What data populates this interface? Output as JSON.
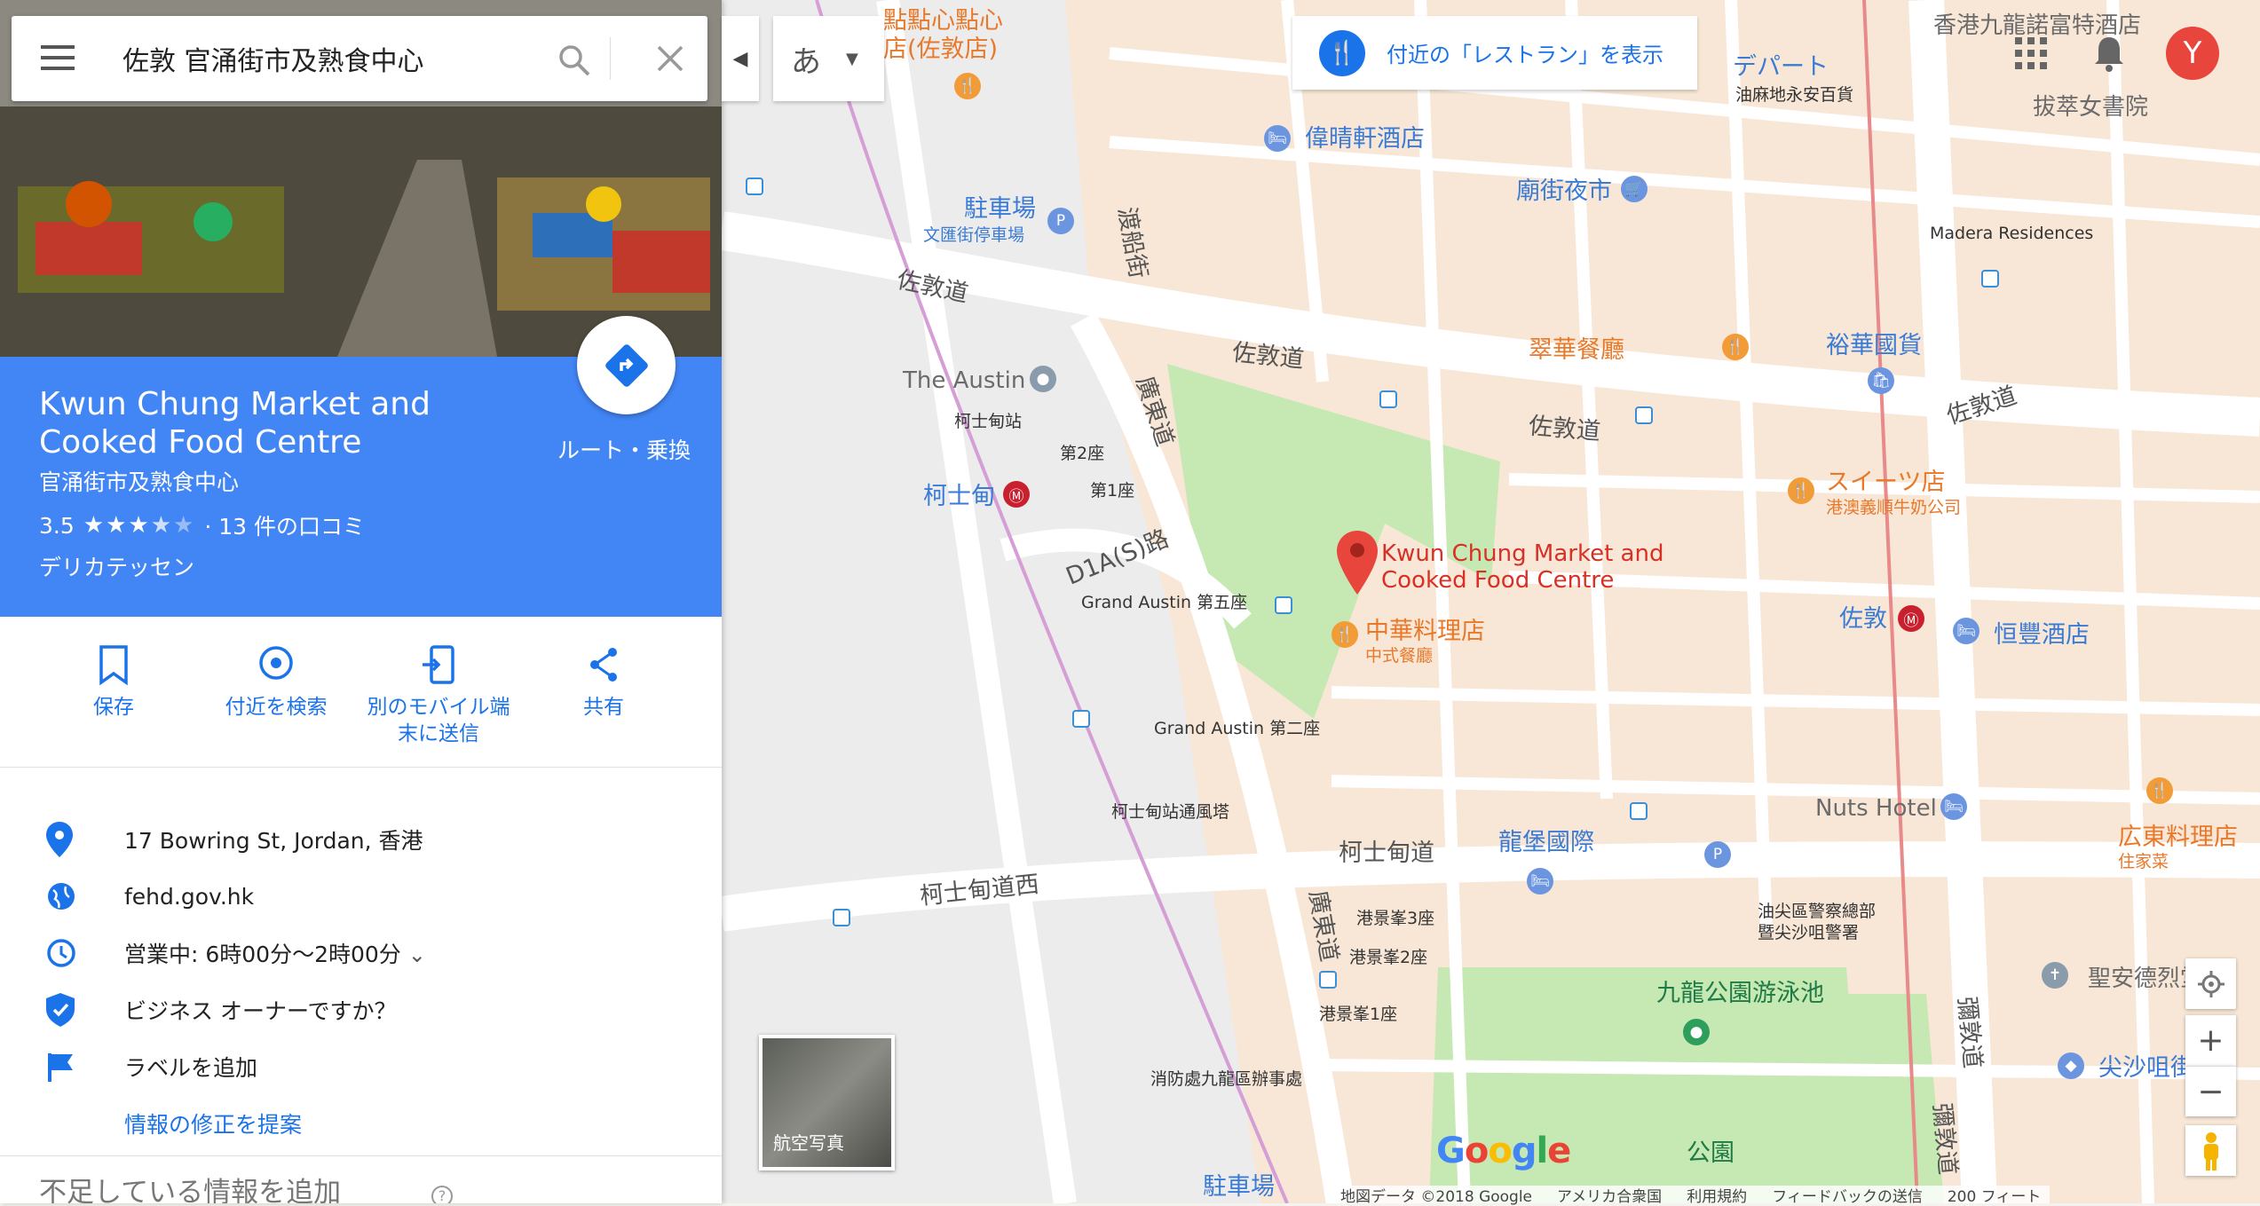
{
  "search": {
    "query": "佐敦 官涌街市及熟食中心"
  },
  "place": {
    "title": "Kwun Chung Market and Cooked Food Centre",
    "subtitle": "官涌街市及熟食中心",
    "rating": "3.5",
    "stars": 3.5,
    "reviews": "· 13 件の口コミ",
    "category": "デリカテッセン",
    "route_label": "ルート・乗換"
  },
  "actions": [
    {
      "label": "保存"
    },
    {
      "label": "付近を検索"
    },
    {
      "label": "別のモバイル端末に送信"
    },
    {
      "label": "共有"
    }
  ],
  "info": {
    "address": "17 Bowring St, Jordan, 香港",
    "website": "fehd.gov.hk",
    "hours": "営業中:  6時00分～2時00分",
    "owner": "ビジネス オーナーですか？",
    "label": "ラベルを追加",
    "suggest": "情報の修正を提案",
    "missing": "不足している情報を追加"
  },
  "top": {
    "ime": "あ",
    "nearby": "付近の「レストラン」を表示",
    "avatar": "Y"
  },
  "map": {
    "aerial": "航空写真",
    "footer": [
      "地図データ ©2018 Google",
      "アメリカ合衆国",
      "利用規約",
      "フィードバックの送信",
      "200 フィート"
    ],
    "labels": {
      "dim_sum": "點點心點心",
      "dim_sum2": "店(佐敦店)",
      "depart": "デパート",
      "sogo": "油麻地永安百貨",
      "hotel1": "香港九龍諾富特酒店",
      "hotel2": "偉晴軒酒店",
      "temple_st": "廟街夜市",
      "school": "拔萃女書院",
      "parking": "駐車場",
      "parking_sub": "文匯街停車場",
      "austin": "The Austin",
      "austin_st": "柯士甸",
      "chuihua": "翠華餐廳",
      "yuehwa": "裕華國貨",
      "sweets": "スイーツ店",
      "sweets_sub": "港澳義順牛奶公司",
      "pin_title": "Kwun Chung Market and Cooked Food Centre",
      "chinese": "中華料理店",
      "chinese_sub": "中式餐廳",
      "jordan": "佐敦",
      "hangfung": "恒豐酒店",
      "nuts": "Nuts Hotel",
      "lungpo": "龍堡國際",
      "cantonese": "広東料理店",
      "cantonese_sub": "住家菜",
      "pool": "九龍公園游泳池",
      "park": "公園",
      "cathedral": "聖安德烈堂",
      "tst": "尖沙咀街",
      "jordan_rd1": "佐敦道",
      "jordan_rd2": "佐敦道",
      "jordan_rd3": "佐敦道",
      "jordan_rd4": "佐敦道",
      "austin_rd": "柯士甸道",
      "austin_rd_w": "柯士甸道西",
      "canton_rd": "廣東道",
      "canton_rd2": "廣東道",
      "d1a": "D1A(S)路",
      "ferry_st": "渡船街",
      "nathan_rd": "彌敦道",
      "nathan_rd2": "彌敦道",
      "gatsby": "Madera Residences",
      "police": "油尖區警察總部",
      "police2": "暨尖沙咀警署",
      "fire": "消防處九龍區辦事處",
      "grand5": "Grand Austin 第五座",
      "grand2": "Grand Austin 第二座",
      "austin_stn": "柯士甸站",
      "tower2": "第2座",
      "tower1": "第1座",
      "vent": "柯士甸站通風塔",
      "gh1": "港景峯1座",
      "gh2": "港景峯2座",
      "gh3": "港景峯3座",
      "parking2": "駐車場"
    }
  }
}
